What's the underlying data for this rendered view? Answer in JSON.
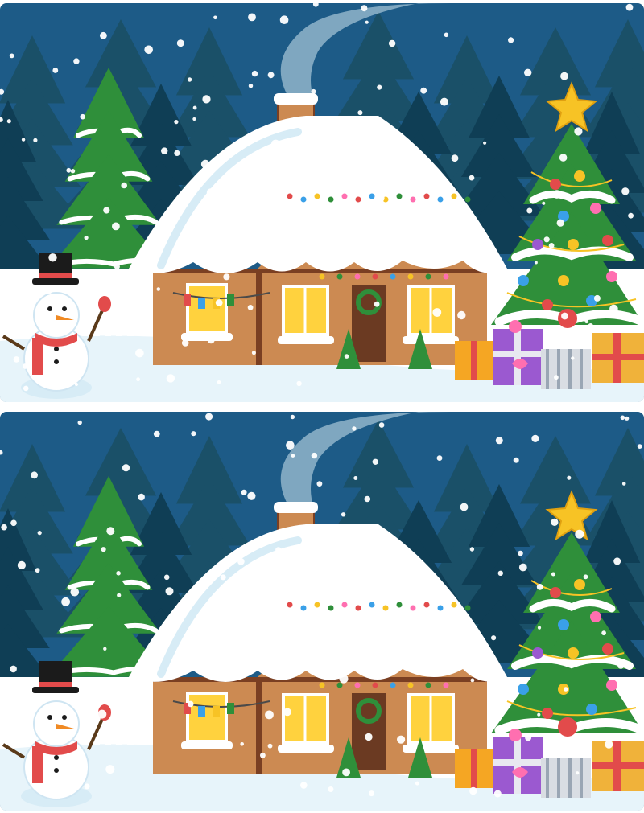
{
  "puzzle": {
    "type": "spot-the-difference",
    "panels": [
      {
        "id": "top",
        "variant": "original"
      },
      {
        "id": "bottom",
        "variant": "modified"
      }
    ]
  },
  "colors": {
    "sky": "#1d5b87",
    "forest_dark": "#0f3e55",
    "forest_mid": "#1a5068",
    "snow": "#ffffff",
    "snow_shadow": "#d7ecf6",
    "brick": "#cc8a52",
    "timber": "#7a3f22",
    "window_glow": "#ffd23e",
    "tree_green": "#2f8f3a",
    "star": "#f7c325"
  },
  "icons": [
    "snowman-icon",
    "christmas-tree-icon",
    "house-icon",
    "star-icon",
    "gift-icon",
    "wreath-icon"
  ]
}
